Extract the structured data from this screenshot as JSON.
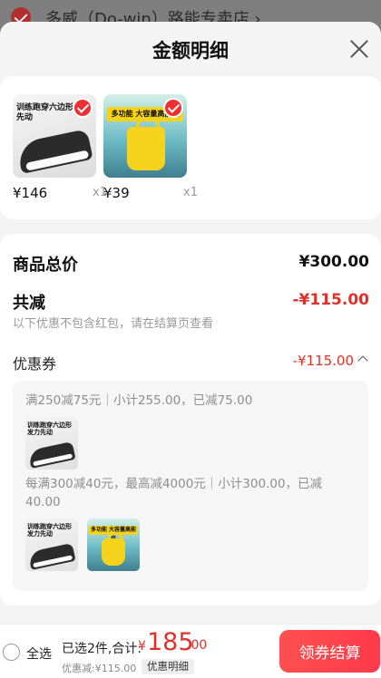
{
  "background": {
    "store_name": "多威（Do-win）路能专卖店 ›"
  },
  "sheet": {
    "title": "金额明细"
  },
  "products": [
    {
      "price": "¥146",
      "qty": "x1",
      "image_text": "训练跑穿六边形 发力先动",
      "image_kind": "shoe"
    },
    {
      "price": "¥39",
      "qty": "x1",
      "image_text": "多功能 大容量高能装",
      "image_kind": "bag"
    }
  ],
  "summary": {
    "total_label": "商品总价",
    "total_value": "¥300.00",
    "discount_label": "共减",
    "discount_value": "-¥115.00",
    "note": "以下优惠不包含红包，请在结算页查看",
    "coupon_label": "优惠券",
    "coupon_value": "-¥115.00"
  },
  "coupon_rules": [
    {
      "text": "满250减75元｜小计255.00，已减75.00",
      "items": [
        "shoe"
      ]
    },
    {
      "text": "每满300减40元，最高减4000元｜小计300.00，已减40.00",
      "items": [
        "shoe",
        "bag"
      ]
    }
  ],
  "bottom_bar": {
    "select_all": "全选",
    "selected_text": "已选2件,合计:",
    "currency": "¥",
    "total_int": "185",
    "total_dec": ".00",
    "saved": "优惠减:¥115.00",
    "detail_tag": "优惠明细",
    "checkout": "领券结算"
  },
  "colors": {
    "accent_red": "#e0302a",
    "checkout_bg": "#ff4545"
  },
  "icons": [
    "checkmark-icon",
    "close-icon",
    "chevron-up-icon",
    "radio-icon"
  ]
}
